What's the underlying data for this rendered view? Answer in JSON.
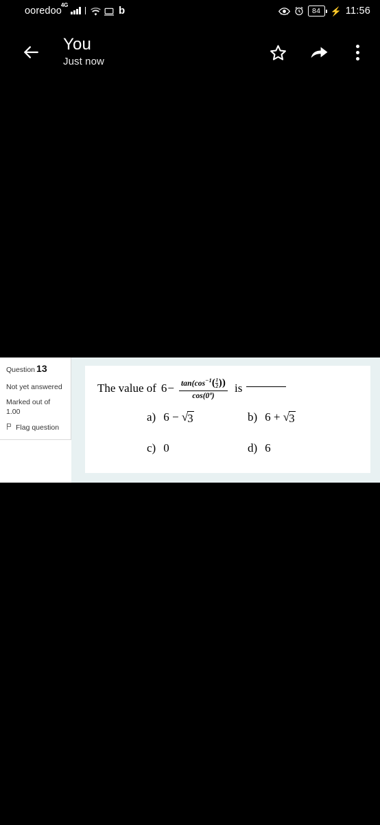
{
  "status_bar": {
    "carrier": "ooredoo",
    "network_type": "4G",
    "icons": [
      "signal-bars-icon",
      "wifi-icon",
      "cast-screen-icon",
      "bluetooth-b-icon",
      "eye-icon",
      "alarm-clock-icon"
    ],
    "battery_level": "84",
    "charging": true,
    "time": "11:56"
  },
  "app_bar": {
    "back_icon": "back-arrow-icon",
    "title": "You",
    "subtitle": "Just now",
    "actions": [
      {
        "name": "star-icon",
        "label": "Star"
      },
      {
        "name": "share-icon",
        "label": "Share"
      },
      {
        "name": "overflow-menu-icon",
        "label": "More options"
      }
    ]
  },
  "question": {
    "number_label": "Question",
    "number": "13",
    "status": "Not yet answered",
    "marked_label": "Marked out of",
    "marked_value": "1.00",
    "flag_label": "Flag question",
    "flag_icon": "flag-icon",
    "stem_lead": "The value of",
    "stem_base": "6",
    "stem_minus": "−",
    "fraction": {
      "numerator_fn": "tan(cos",
      "numerator_sup": "−1",
      "numerator_arg_num": "1",
      "numerator_arg_den": "2",
      "numerator_close": "))",
      "denominator": "cos(0º)"
    },
    "stem_tail": "is",
    "blank": "______",
    "options": [
      {
        "label": "a)",
        "value": "6 − √3",
        "base": "6 −",
        "radicand": "3"
      },
      {
        "label": "b)",
        "value": "6 + √3",
        "base": "6 +",
        "radicand": "3"
      },
      {
        "label": "c)",
        "value": "0",
        "base": "0",
        "radicand": ""
      },
      {
        "label": "d)",
        "value": "6",
        "base": "6",
        "radicand": ""
      }
    ]
  },
  "colors": {
    "background": "#000000",
    "sheet": "#ffffff",
    "panel_tint": "#e8f1f2",
    "card": "#ffffff",
    "text": "#000000",
    "info_text": "#333333",
    "border": "#d9d9d9"
  }
}
